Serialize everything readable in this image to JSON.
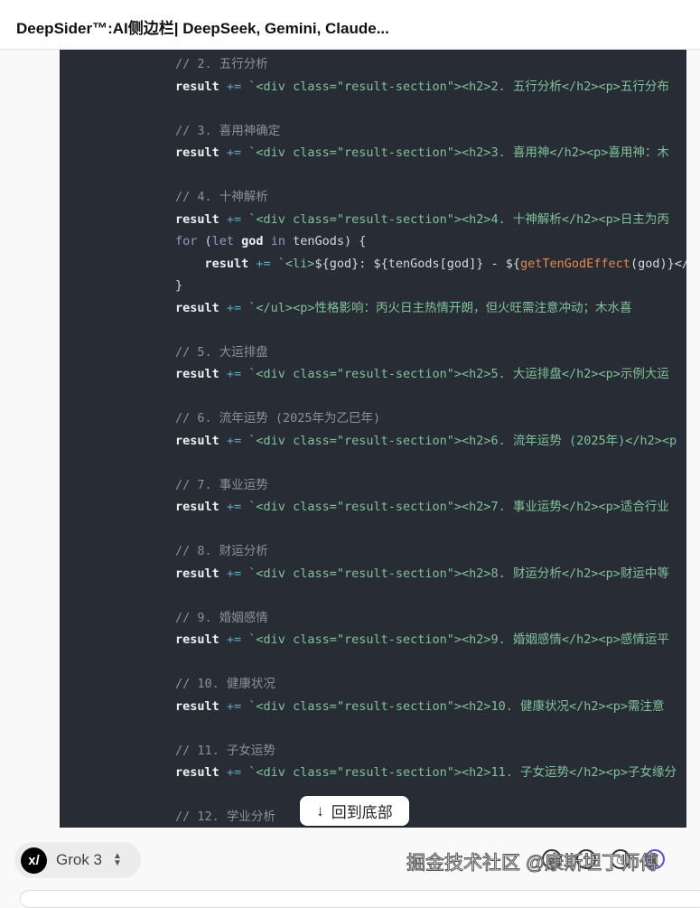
{
  "header": {
    "title": "DeepSider™:AI侧边栏| DeepSeek, Gemini, Claude..."
  },
  "code_lines": [
    [
      [
        "// 2. 五行分析",
        "c"
      ]
    ],
    [
      [
        "result",
        "v"
      ],
      [
        " += ",
        "o"
      ],
      [
        "`<div class=\"result-section\"><h2>2. 五行分析</h2><p>五行分布",
        "s"
      ]
    ],
    [],
    [
      [
        "// 3. 喜用神确定",
        "c"
      ]
    ],
    [
      [
        "result",
        "v"
      ],
      [
        " += ",
        "o"
      ],
      [
        "`<div class=\"result-section\"><h2>3. 喜用神</h2><p>喜用神：木",
        "s"
      ]
    ],
    [],
    [
      [
        "// 4. 十神解析",
        "c"
      ]
    ],
    [
      [
        "result",
        "v"
      ],
      [
        " += ",
        "o"
      ],
      [
        "`<div class=\"result-section\"><h2>4. 十神解析</h2><p>日主为丙",
        "s"
      ]
    ],
    [
      [
        "for",
        "k"
      ],
      [
        " (",
        "p"
      ],
      [
        "let",
        "k"
      ],
      [
        " god ",
        "v"
      ],
      [
        "in",
        "k"
      ],
      [
        " tenGods) {",
        "p"
      ]
    ],
    [
      [
        "    result",
        "v"
      ],
      [
        " += ",
        "o"
      ],
      [
        "`<li>",
        "s"
      ],
      [
        "${god}: ${tenGods[god]} - ${",
        "p"
      ],
      [
        "getTenGodEffect",
        "f"
      ],
      [
        "(god)}</",
        "p"
      ]
    ],
    [
      [
        "}",
        "p"
      ]
    ],
    [
      [
        "result",
        "v"
      ],
      [
        " += ",
        "o"
      ],
      [
        "`</ul><p>性格影响：丙火日主热情开朗，但火旺需注意冲动；木水喜",
        "s"
      ]
    ],
    [],
    [
      [
        "// 5. 大运排盘",
        "c"
      ]
    ],
    [
      [
        "result",
        "v"
      ],
      [
        " += ",
        "o"
      ],
      [
        "`<div class=\"result-section\"><h2>5. 大运排盘</h2><p>示例大运",
        "s"
      ]
    ],
    [],
    [
      [
        "// 6. 流年运势 (2025年为乙巳年)",
        "c"
      ]
    ],
    [
      [
        "result",
        "v"
      ],
      [
        " += ",
        "o"
      ],
      [
        "`<div class=\"result-section\"><h2>6. 流年运势 (2025年)</h2><p",
        "s"
      ]
    ],
    [],
    [
      [
        "// 7. 事业运势",
        "c"
      ]
    ],
    [
      [
        "result",
        "v"
      ],
      [
        " += ",
        "o"
      ],
      [
        "`<div class=\"result-section\"><h2>7. 事业运势</h2><p>适合行业",
        "s"
      ]
    ],
    [],
    [
      [
        "// 8. 财运分析",
        "c"
      ]
    ],
    [
      [
        "result",
        "v"
      ],
      [
        " += ",
        "o"
      ],
      [
        "`<div class=\"result-section\"><h2>8. 财运分析</h2><p>财运中等",
        "s"
      ]
    ],
    [],
    [
      [
        "// 9. 婚姻感情",
        "c"
      ]
    ],
    [
      [
        "result",
        "v"
      ],
      [
        " += ",
        "o"
      ],
      [
        "`<div class=\"result-section\"><h2>9. 婚姻感情</h2><p>感情运平",
        "s"
      ]
    ],
    [],
    [
      [
        "// 10. 健康状况",
        "c"
      ]
    ],
    [
      [
        "result",
        "v"
      ],
      [
        " += ",
        "o"
      ],
      [
        "`<div class=\"result-section\"><h2>10. 健康状况</h2><p>需注意",
        "s"
      ]
    ],
    [],
    [
      [
        "// 11. 子女运势",
        "c"
      ]
    ],
    [
      [
        "result",
        "v"
      ],
      [
        " += ",
        "o"
      ],
      [
        "`<div class=\"result-section\"><h2>11. 子女运势</h2><p>子女缘分",
        "s"
      ]
    ],
    [],
    [
      [
        "// 12. 学业分析",
        "c"
      ]
    ]
  ],
  "scroll_button": {
    "label": "回到底部",
    "icon": "arrow-down-icon"
  },
  "model_selector": {
    "logo": "xI",
    "label": "Grok 3"
  },
  "watermark": "掘金技术社区 @康斯坦丁师傅",
  "colors": {
    "code_bg": "#282c34",
    "comment": "#8d9098",
    "string": "#7fc29b",
    "function": "#e58a4e",
    "send": "#5b4bd6"
  }
}
